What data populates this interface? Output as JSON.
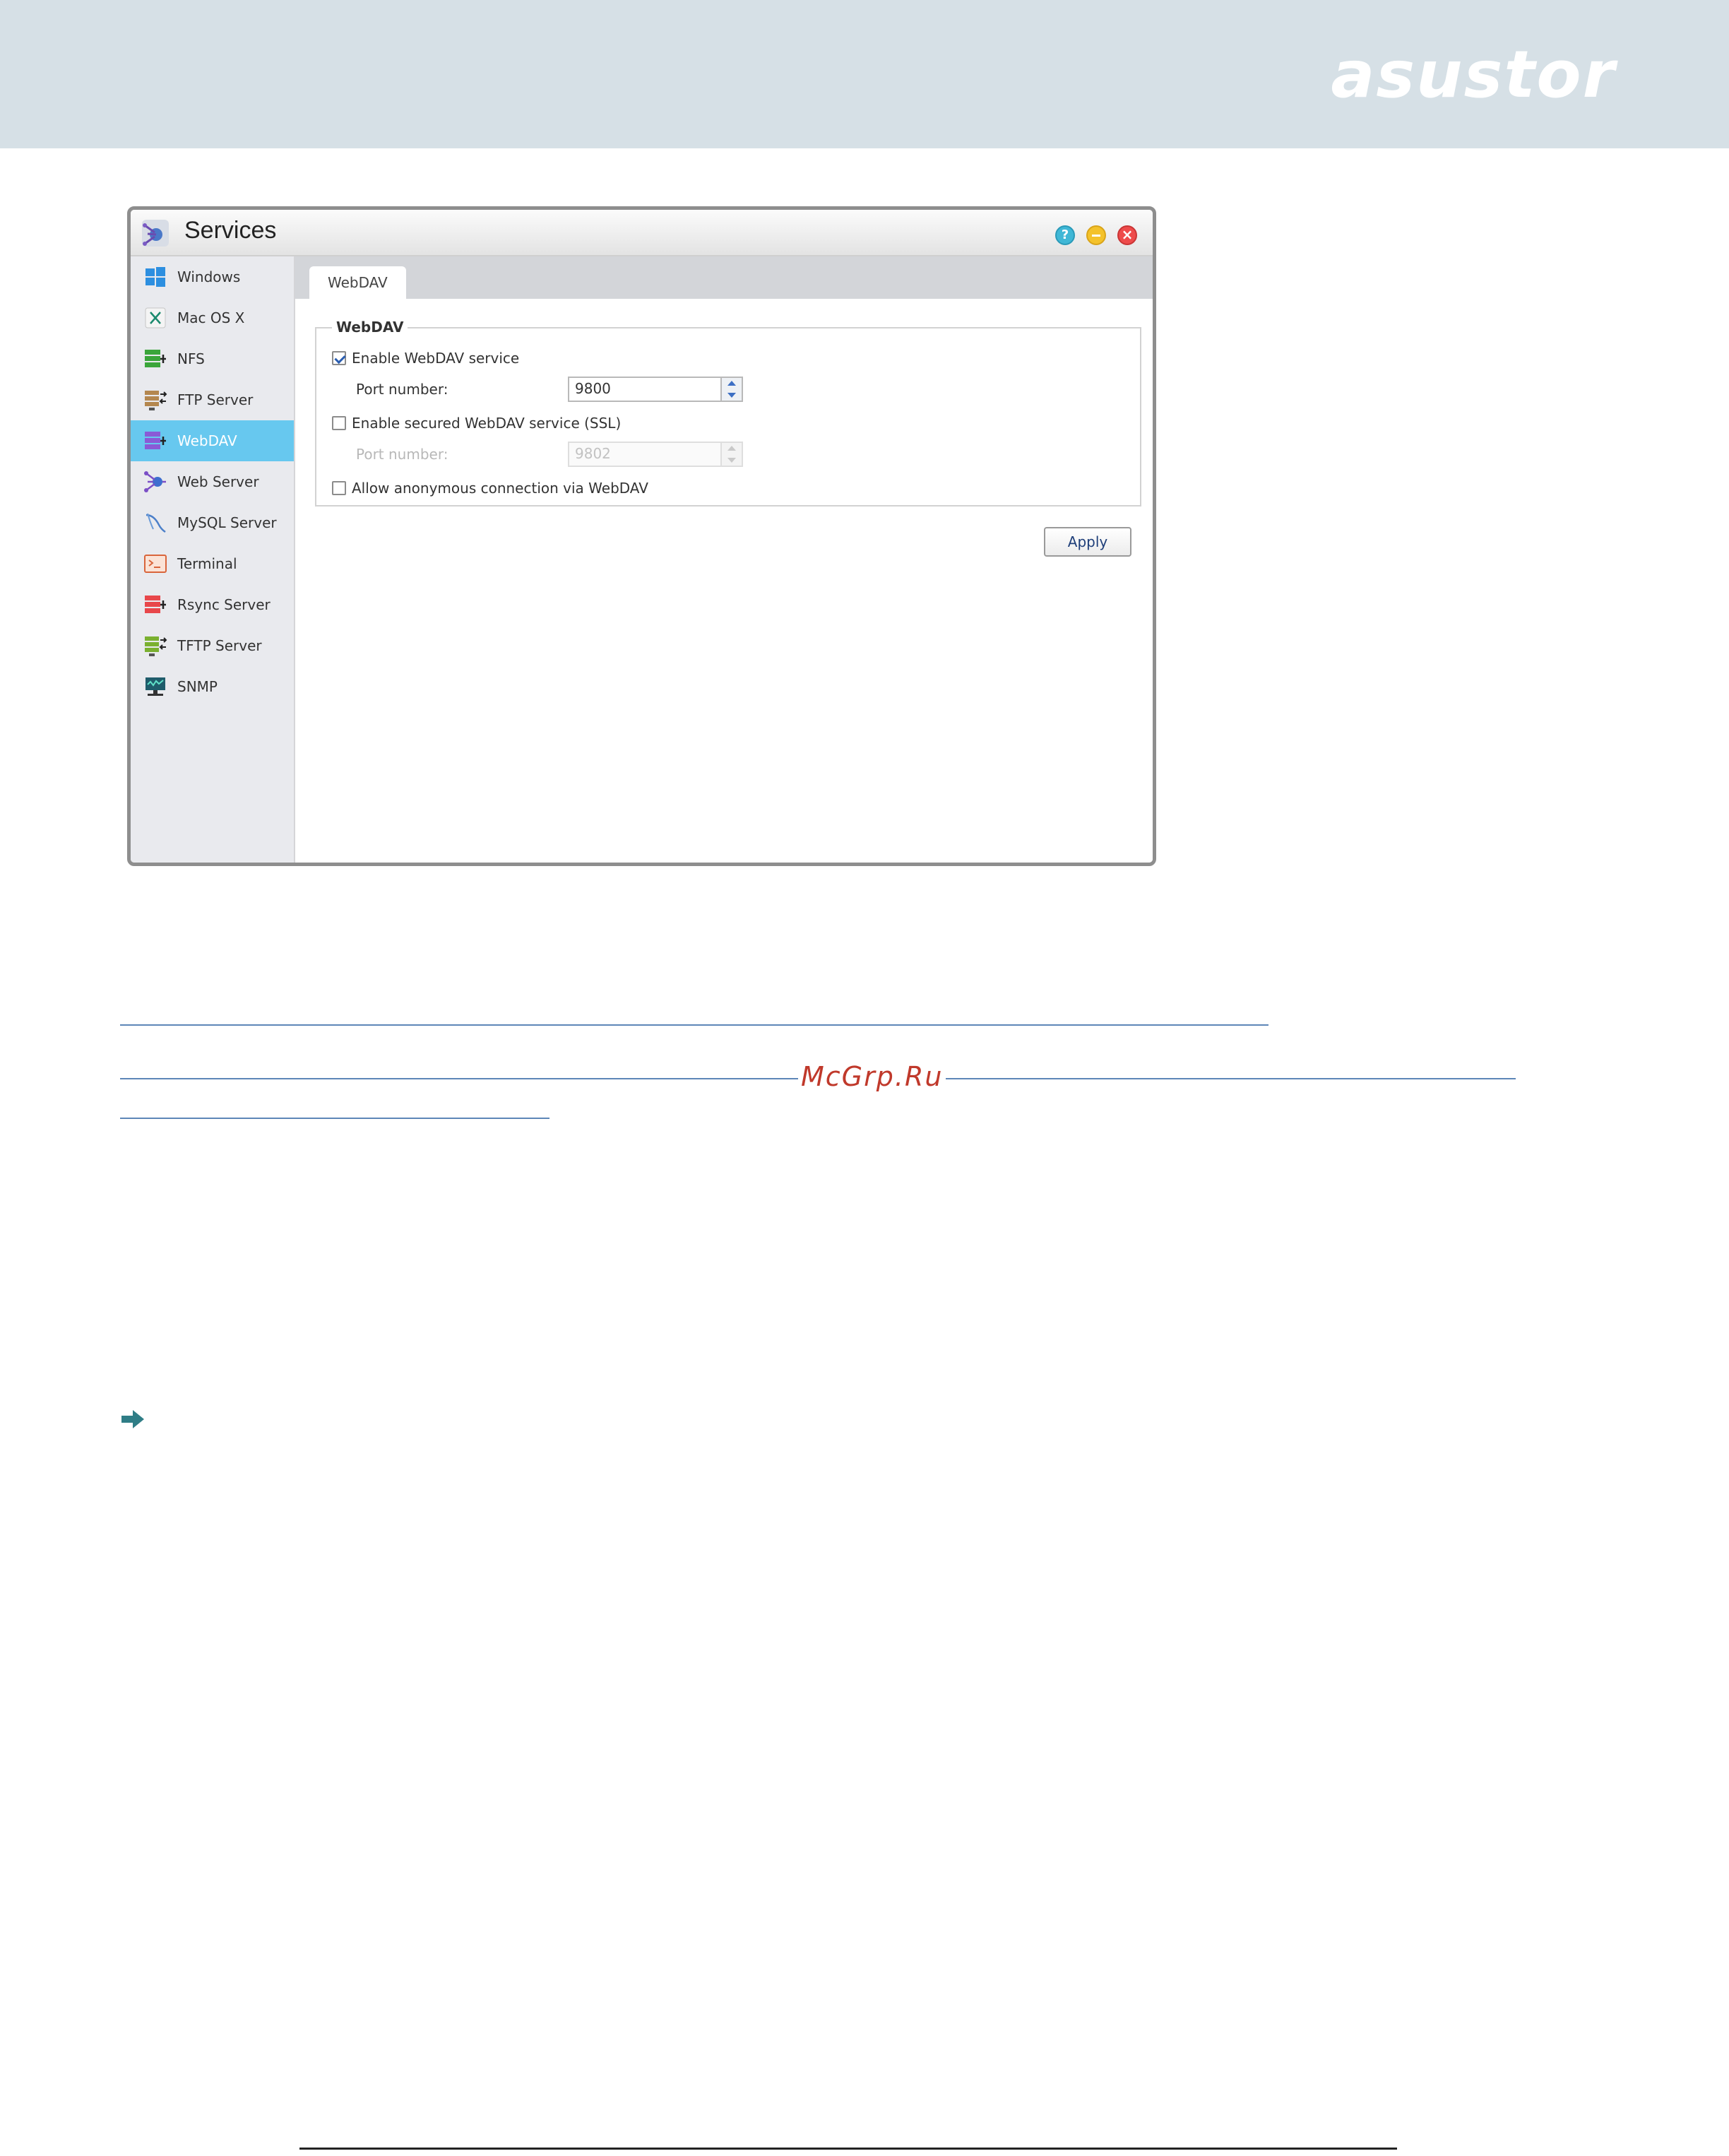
{
  "brand": {
    "logo_text": "asustor"
  },
  "window": {
    "title": "Services",
    "controls": {
      "help_icon": "help-icon",
      "minimize_icon": "minimize-icon",
      "close_icon": "close-icon"
    }
  },
  "sidebar": {
    "items": [
      {
        "label": "Windows",
        "icon": "windows-icon"
      },
      {
        "label": "Mac OS X",
        "icon": "mac-os-x-icon"
      },
      {
        "label": "NFS",
        "icon": "nfs-icon"
      },
      {
        "label": "FTP Server",
        "icon": "ftp-server-icon"
      },
      {
        "label": "WebDAV",
        "icon": "webdav-icon",
        "active": true
      },
      {
        "label": "Web Server",
        "icon": "web-server-icon"
      },
      {
        "label": "MySQL Server",
        "icon": "mysql-server-icon"
      },
      {
        "label": "Terminal",
        "icon": "terminal-icon"
      },
      {
        "label": "Rsync Server",
        "icon": "rsync-server-icon"
      },
      {
        "label": "TFTP Server",
        "icon": "tftp-server-icon"
      },
      {
        "label": "SNMP",
        "icon": "snmp-icon"
      }
    ]
  },
  "main": {
    "tabs": [
      {
        "label": "WebDAV"
      }
    ],
    "fieldset": {
      "legend": "WebDAV",
      "enable_webdav": {
        "label": "Enable WebDAV service",
        "checked": true
      },
      "port": {
        "label": "Port number:",
        "value": "9800"
      },
      "enable_ssl": {
        "label": "Enable secured WebDAV service (SSL)",
        "checked": false
      },
      "ssl_port": {
        "label": "Port number:",
        "value": "9802",
        "disabled": true
      },
      "allow_anonymous": {
        "label": "Allow anonymous connection via WebDAV",
        "checked": false
      }
    },
    "apply_label": "Apply"
  },
  "watermark": {
    "text": "McGrp.Ru"
  },
  "colors": {
    "active_nav": "#67c8ef",
    "header_band": "#d6e0e6",
    "link_line": "#5d86b8",
    "watermark": "#c0392b"
  }
}
